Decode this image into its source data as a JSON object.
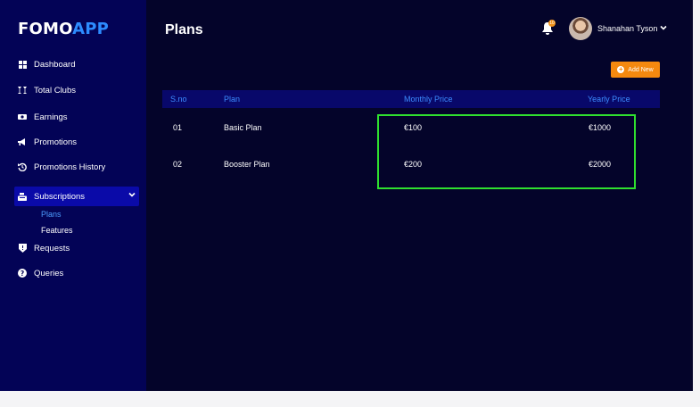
{
  "brand": {
    "part1": "FOMO",
    "part2": "APP"
  },
  "sidebar": {
    "items": [
      {
        "label": "Dashboard",
        "icon": "grid-icon"
      },
      {
        "label": "Total Clubs",
        "icon": "cocktail-icon"
      },
      {
        "label": "Earnings",
        "icon": "money-icon"
      },
      {
        "label": "Promotions",
        "icon": "megaphone-icon"
      },
      {
        "label": "Promotions History",
        "icon": "history-icon"
      },
      {
        "label": "Subscriptions",
        "icon": "cash-register-icon",
        "expanded": true
      },
      {
        "label": "Requests",
        "icon": "shield-icon"
      },
      {
        "label": "Queries",
        "icon": "question-icon"
      }
    ],
    "subitems": [
      {
        "label": "Plans",
        "current": true
      },
      {
        "label": "Features",
        "current": false
      }
    ]
  },
  "header": {
    "title": "Plans",
    "notification_count": "10",
    "user_name": "Shanahan Tyson"
  },
  "actions": {
    "add_new_label": "Add New"
  },
  "table": {
    "columns": [
      "S.no",
      "Plan",
      "Monthly Price",
      "Yearly Price"
    ],
    "rows": [
      [
        "01",
        "Basic Plan",
        "€100",
        "€1000"
      ],
      [
        "02",
        "Booster Plan",
        "€200",
        "€2000"
      ]
    ]
  },
  "colors": {
    "background": "#04042a",
    "sidebar": "#030356",
    "accent_blue": "#2d8cff",
    "active_nav": "#0a0aa8",
    "button_orange": "#f5890f",
    "highlight_green": "#2fe02f"
  }
}
